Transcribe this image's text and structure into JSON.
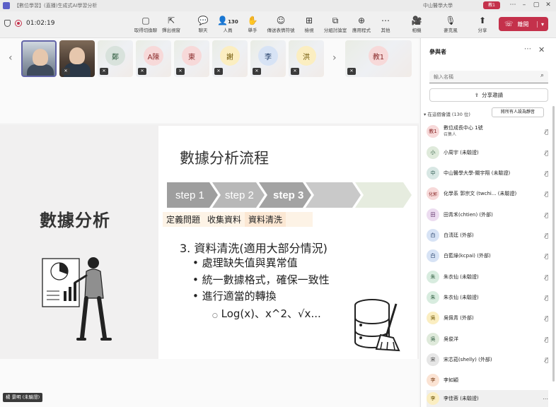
{
  "window": {
    "title": "【數位學習】(直播)生成式AI學習分析",
    "org": "中山醫學大學",
    "org_badge": "教1"
  },
  "toolbar": {
    "elapsed": "01:02:19",
    "items": [
      {
        "label": "取得切換聊",
        "icon": "▢"
      },
      {
        "label": "彈出視窗",
        "icon": "⇱"
      },
      {
        "label": "聊天",
        "icon": "💬"
      },
      {
        "label": "人員",
        "icon": "👤",
        "count": "130"
      },
      {
        "label": "舉手",
        "icon": "✋"
      },
      {
        "label": "傳送表情符號",
        "icon": "☺"
      },
      {
        "label": "檢視",
        "icon": "⊞"
      },
      {
        "label": "分組討論室",
        "icon": "⧉"
      },
      {
        "label": "應用程式",
        "icon": "⊕"
      },
      {
        "label": "其他",
        "icon": "⋯"
      },
      {
        "label": "相機",
        "icon": "🎥"
      },
      {
        "label": "麥克風",
        "icon": "🎙"
      },
      {
        "label": "分享",
        "icon": "⬆"
      }
    ],
    "leave_label": "離開"
  },
  "strip": {
    "tiles": [
      {
        "initial": "",
        "kind": "cam1"
      },
      {
        "initial": "",
        "kind": "cam2"
      },
      {
        "initial": "鄭",
        "color": "#d8e2dc",
        "fg": "#2d5a3d"
      },
      {
        "initial": "A陳",
        "color": "#f7d9d9",
        "fg": "#8a2b2b"
      },
      {
        "initial": "東",
        "color": "#f7d9d9",
        "fg": "#8a2b2b"
      },
      {
        "initial": "謝",
        "color": "#fbeec1",
        "fg": "#6b5200"
      },
      {
        "initial": "李",
        "color": "#d7e3f5",
        "fg": "#1f3a64"
      },
      {
        "initial": "洪",
        "color": "#fbeec1",
        "fg": "#6b5200"
      },
      {
        "initial": "教1",
        "color": "#f7d9d9",
        "fg": "#8a2b2b"
      }
    ]
  },
  "slide": {
    "left_title": "數據分析",
    "title": "數據分析流程",
    "steps": [
      "step 1",
      "step 2",
      "step 3"
    ],
    "labels": [
      "定義問題",
      "收集資料",
      "資料清洗"
    ],
    "heading": "3.  資料清洗(適用大部分情況)",
    "bullets": [
      "處理缺失值與異常值",
      "統一數據格式，確保一致性",
      "進行適當的轉換"
    ],
    "sub_bullet": "Log(x)、x^2、√x..."
  },
  "presenter_tag": "楊 景明 (未驗證)",
  "panel": {
    "title": "參與者",
    "search_placeholder": "輸入名稱",
    "share_label": "分享邀請",
    "section": "在這個會議 (130 位)",
    "allow_label": "將所有人設為靜音",
    "participants": [
      {
        "initial": "教1",
        "name": "數位成長中心 1號",
        "role": "召集人",
        "color": "#f7d9d9",
        "fg": "#8a2b2b"
      },
      {
        "initial": "小",
        "name": "小周宇 (未驗證)",
        "color": "#dfeadb",
        "fg": "#2d5a3d"
      },
      {
        "initial": "中",
        "name": "中山醫學大學-關宇翔 (未驗證)",
        "color": "#d8e7e4",
        "fg": "#2d5a50"
      },
      {
        "initial": "化郭",
        "name": "化學系 郭宗文 (twchi... (未驗證)",
        "color": "#f7d9d9",
        "fg": "#8a2b2b"
      },
      {
        "initial": "田",
        "name": "田青禾(chtien) (外部)",
        "color": "#ecdcf0",
        "fg": "#5a2d64"
      },
      {
        "initial": "白",
        "name": "白淸廷 (外部)",
        "color": "#d7e3f5",
        "fg": "#1f3a64"
      },
      {
        "initial": "白",
        "name": "白藍綠(kcpai) (外部)",
        "color": "#d7e3f5",
        "fg": "#1f3a64"
      },
      {
        "initial": "朱",
        "name": "朱衣仙 (未驗證)",
        "color": "#d8ecdf",
        "fg": "#2d5a3d"
      },
      {
        "initial": "朱",
        "name": "朱衣仙 (未驗證)",
        "color": "#d8ecdf",
        "fg": "#2d5a3d"
      },
      {
        "initial": "吳",
        "name": "吳佩青 (外部)",
        "color": "#fbeec1",
        "fg": "#6b5200"
      },
      {
        "initial": "吳",
        "name": "吳俊洋",
        "color": "#dfeadb",
        "fg": "#2d5a3d"
      },
      {
        "initial": "宋",
        "name": "宋芯茹(shelly) (外部)",
        "color": "#e6e6e6",
        "fg": "#444444"
      },
      {
        "initial": "李",
        "name": "李如穎",
        "color": "#fbe3d3",
        "fg": "#7a3d14"
      },
      {
        "initial": "李",
        "name": "李佳蓉 (未驗證)",
        "color": "#fbeec1",
        "fg": "#6b5200"
      }
    ]
  }
}
